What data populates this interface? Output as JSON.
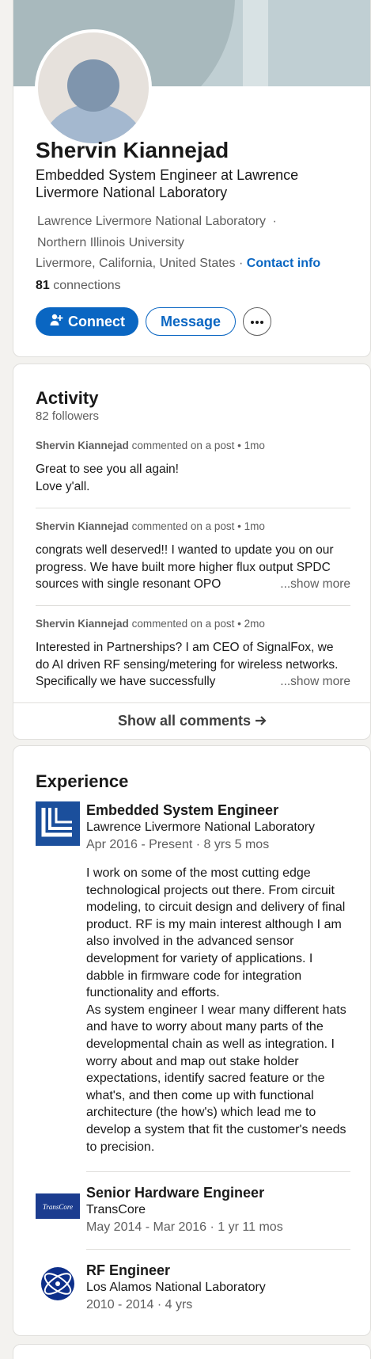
{
  "profile": {
    "name": "Shervin Kiannejad",
    "headline": "Embedded System Engineer at Lawrence Livermore National Laboratory",
    "org_current": "Lawrence Livermore National Laboratory",
    "org_separator": "·",
    "org_education": "Northern Illinois University",
    "location": "Livermore, California, United States",
    "location_separator": "·",
    "contact_info": "Contact info",
    "connections_count": "81",
    "connections_label": "connections",
    "connect_label": "Connect",
    "message_label": "Message",
    "more_icon": "ellipsis-icon",
    "connect_icon": "add-person-icon"
  },
  "activity": {
    "title": "Activity",
    "followers": "82 followers",
    "show_more": "...show more",
    "items": [
      {
        "author": "Shervin Kiannejad",
        "action": "commented on a post",
        "time": "1mo",
        "text_line1": "Great to see you all again!",
        "text_line2": "Love y'all."
      },
      {
        "author": "Shervin Kiannejad",
        "action": "commented on a post",
        "time": "1mo",
        "text": "congrats well deserved!! I wanted to update you on our progress. We have built more higher flux output SPDC sources with single resonant OPO"
      },
      {
        "author": "Shervin Kiannejad",
        "action": "commented on a post",
        "time": "2mo",
        "text": "Interested in Partnerships? I am CEO of SignalFox, we do AI driven RF sensing/metering for wireless networks. Specifically we have successfully"
      }
    ],
    "show_all": "Show all comments",
    "arrow_icon": "arrow-right-icon"
  },
  "experience": {
    "title": "Experience",
    "items": [
      {
        "title": "Embedded System Engineer",
        "company": "Lawrence Livermore National Laboratory",
        "dates": "Apr 2016 - Present · 8 yrs 5 mos",
        "description_p1": "I work on some of the most cutting edge technological projects out there. From circuit modeling, to circuit design and delivery of final product. RF is my main interest although I am also involved in the advanced sensor development for variety of applications. I dabble in firmware code for integration functionality and efforts.",
        "description_p2": "As system engineer I wear many different hats and have to worry about many parts of the developmental chain as well as integration. I worry about and map out stake holder expectations, identify sacred feature or the what's, and then come up with functional architecture (the how's) which lead me to develop a system that fit the customer's needs to precision."
      },
      {
        "title": "Senior Hardware Engineer",
        "company": "TransCore",
        "dates": "May 2014 - Mar 2016 · 1 yr 11 mos",
        "logo_text": "TransCore"
      },
      {
        "title": "RF Engineer",
        "company": "Los Alamos National Laboratory",
        "dates": "2010 - 2014 · 4 yrs"
      }
    ]
  },
  "colors": {
    "accent": "#0a66c2",
    "background": "#f3f2ef",
    "llnl_blue": "#1b4f9c",
    "transcore_blue": "#1b3c8f",
    "lanl_blue": "#0d2f8a"
  }
}
